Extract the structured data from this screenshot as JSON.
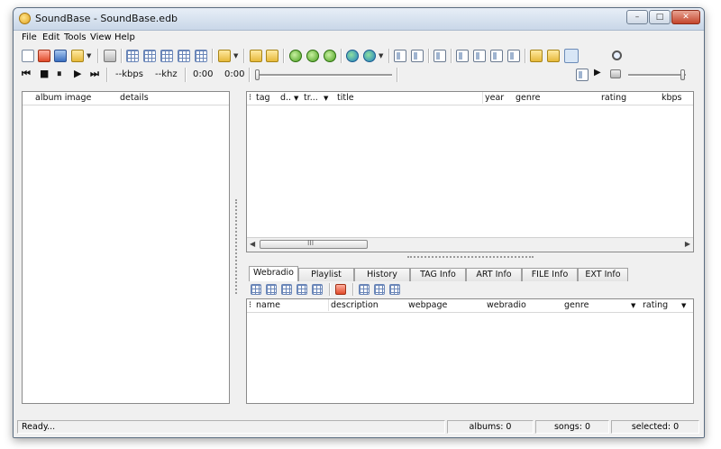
{
  "window": {
    "title": "SoundBase - SoundBase.edb",
    "minimize_glyph": "–",
    "maximize_glyph": "□",
    "close_glyph": "✕"
  },
  "menu": [
    "File",
    "Edit",
    "Tools",
    "View",
    "Help"
  ],
  "player": {
    "prev_glyph": "⏮",
    "stop_glyph": "■",
    "pause_glyph": "⏸",
    "play_glyph": "▶",
    "next_glyph": "⏭",
    "kbps": "--kbps",
    "khz": "--khz",
    "elapsed": "0:00",
    "total": "0:00"
  },
  "left_panel": {
    "columns": [
      "album image",
      "details"
    ]
  },
  "song_list": {
    "columns": [
      "tag",
      "d..",
      "tr...",
      "title",
      "year",
      "genre",
      "rating",
      "kbps"
    ],
    "scroll_thumb_label": "III"
  },
  "tabs": {
    "labels": [
      "Webradio",
      "Playlist",
      "History",
      "TAG Info",
      "ART Info",
      "FILE Info",
      "EXT Info"
    ],
    "active": "Webradio"
  },
  "webradio": {
    "columns": [
      "name",
      "description",
      "webpage",
      "webradio",
      "genre",
      "rating"
    ]
  },
  "status": {
    "text": "Ready...",
    "albums": "albums: 0",
    "songs": "songs: 0",
    "selected": "selected: 0"
  },
  "icons": {
    "toolbar": [
      "new-icon",
      "open-red-icon",
      "save-icon",
      "folder-open-icon",
      "dropdown-icon",
      "settings-icon",
      "grid-add-icon",
      "grid-edit-icon",
      "grid-delete-icon",
      "grid-icon",
      "grid-refresh-icon",
      "speaker-icon",
      "folder-icon",
      "folder-up-icon",
      "check-green-icon",
      "check-refresh-icon",
      "check-delete-icon",
      "globe-icon",
      "globe-blue-icon",
      "window-icon",
      "panel-left-icon",
      "panel-icon",
      "panel-2-icon",
      "panel-3-icon",
      "panel-4-icon",
      "panel-5-icon",
      "import-icon",
      "export-icon",
      "toggle-view-icon",
      "search-icon"
    ]
  }
}
